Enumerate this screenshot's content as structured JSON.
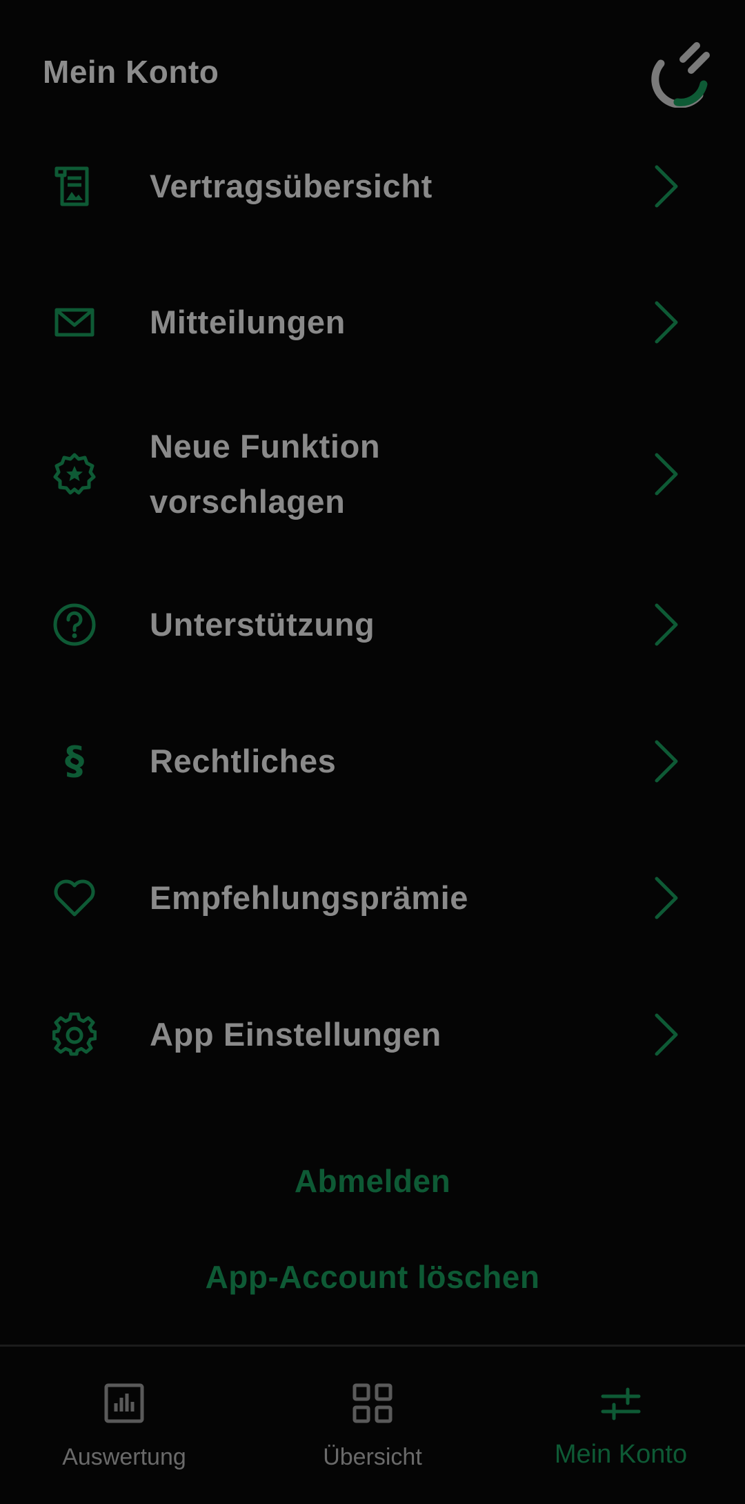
{
  "header": {
    "title": "Mein Konto",
    "logo_icon": "brand-logo-icon"
  },
  "menu": {
    "items": [
      {
        "label": "Vertragsübersicht",
        "icon": "contract-document-icon"
      },
      {
        "label": "Mitteilungen",
        "icon": "envelope-icon"
      },
      {
        "label": "Neue Funktion vorschlagen",
        "icon": "star-badge-icon"
      },
      {
        "label": "Unterstützung",
        "icon": "question-circle-icon"
      },
      {
        "label": "Rechtliches",
        "icon": "paragraph-icon"
      },
      {
        "label": "Empfehlungsprämie",
        "icon": "heart-icon"
      },
      {
        "label": "App Einstellungen",
        "icon": "gear-icon"
      }
    ]
  },
  "actions": {
    "logout": "Abmelden",
    "delete_account": "App-Account löschen"
  },
  "bottom_nav": {
    "items": [
      {
        "label": "Auswertung",
        "icon": "bar-chart-icon",
        "active": false
      },
      {
        "label": "Übersicht",
        "icon": "grid-icon",
        "active": false
      },
      {
        "label": "Mein Konto",
        "icon": "sliders-icon",
        "active": true
      }
    ]
  },
  "colors": {
    "background": "#050505",
    "accent": "#0e5a35",
    "text": "#8a8a8a",
    "muted": "#6a6a6a"
  }
}
